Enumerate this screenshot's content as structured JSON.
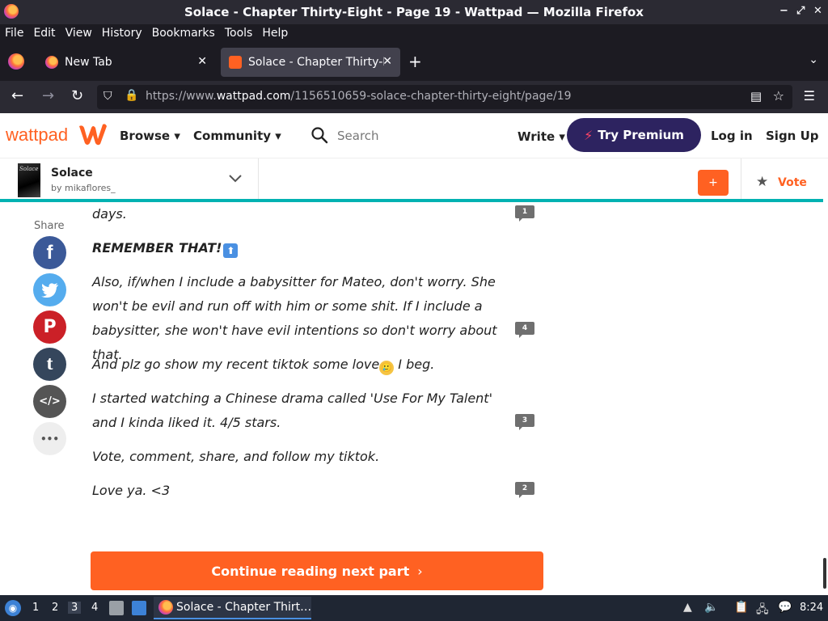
{
  "window": {
    "title": "Solace - Chapter Thirty-Eight - Page 19 - Wattpad — Mozilla Firefox",
    "controls": [
      "−",
      "⤢",
      "✕"
    ]
  },
  "menu": [
    "File",
    "Edit",
    "View",
    "History",
    "Bookmarks",
    "Tools",
    "Help"
  ],
  "tabs": [
    {
      "label": "New Tab",
      "active": false
    },
    {
      "label": "Solace - Chapter Thirty-E",
      "active": true
    }
  ],
  "nav": {
    "url_prefix": "https://www.",
    "url_domain": "wattpad.com",
    "url_path": "/1156510659-solace-chapter-thirty-eight/page/19"
  },
  "header": {
    "logo": "wattpad",
    "browse": "Browse",
    "community": "Community",
    "search_placeholder": "Search",
    "write": "Write",
    "premium": "Try Premium",
    "login": "Log in",
    "signup": "Sign Up"
  },
  "story": {
    "cover_text": "Solace",
    "title": "Solace",
    "author": "by mikaflores_",
    "add": "+",
    "vote": "Vote"
  },
  "share": {
    "label": "Share",
    "buttons": [
      {
        "name": "facebook",
        "glyph": "f",
        "color": "#3b5998"
      },
      {
        "name": "twitter",
        "glyph": "🐦",
        "color": "#55acee"
      },
      {
        "name": "pinterest",
        "glyph": "P",
        "color": "#cb2027"
      },
      {
        "name": "tumblr",
        "glyph": "t",
        "color": "#35465c"
      },
      {
        "name": "embed",
        "glyph": "</>",
        "color": "#555555"
      },
      {
        "name": "more",
        "glyph": "•••",
        "color": "#eeeeee"
      }
    ]
  },
  "content": {
    "p0": "days.",
    "p1": "REMEMBER THAT!",
    "p1_emoji": "⬆",
    "p2": "Also, if/when I include a babysitter for Mateo, don't worry. She won't be evil and run off with him or some shit. If I include a babysitter, she won't have evil intentions so don't worry about that.",
    "p3a": "And plz go show my recent tiktok some love",
    "p3_emoji": "🥲",
    "p3b": " I beg.",
    "p4": "I started watching a Chinese drama called 'Use For My Talent' and I kinda liked it. 4/5 stars.",
    "p5": "Vote, comment, share, and follow my tiktok.",
    "p6": "Love ya. <3",
    "comments": [
      "1",
      "4",
      "3",
      "2"
    ]
  },
  "continue_label": "Continue reading next part",
  "taskbar": {
    "workspaces": [
      "1",
      "2",
      "3",
      "4"
    ],
    "active_workspace": "3",
    "app_label": "Solace - Chapter Thirt…",
    "clock": "8:24"
  }
}
